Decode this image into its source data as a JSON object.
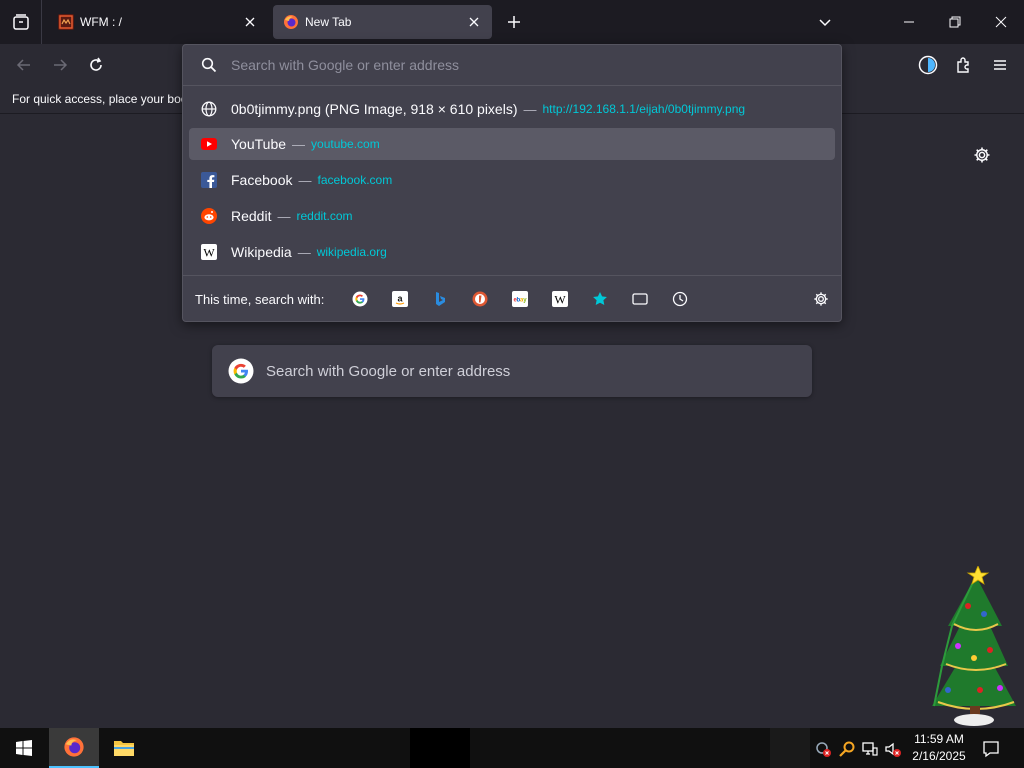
{
  "tabs": [
    {
      "title": "WFM : /",
      "icon": "wfm-icon"
    },
    {
      "title": "New Tab",
      "icon": "firefox-icon"
    }
  ],
  "urlbar": {
    "placeholder": "Search with Google or enter address",
    "results": [
      {
        "title": "0b0tjimmy.png (PNG Image, 918 × 610 pixels)",
        "dash": "—",
        "url": "http://192.168.1.1/eijah/0b0tjimmy.png",
        "icon": "globe-icon",
        "selected": false
      },
      {
        "title": "YouTube",
        "dash": "—",
        "url": "youtube.com",
        "icon": "youtube-icon",
        "selected": true
      },
      {
        "title": "Facebook",
        "dash": "—",
        "url": "facebook.com",
        "icon": "facebook-icon",
        "selected": false
      },
      {
        "title": "Reddit",
        "dash": "—",
        "url": "reddit.com",
        "icon": "reddit-icon",
        "selected": false
      },
      {
        "title": "Wikipedia",
        "dash": "—",
        "url": "wikipedia.org",
        "icon": "wikipedia-icon",
        "selected": false
      }
    ],
    "search_with_label": "This time, search with:",
    "engines": [
      "google-icon",
      "amazon-icon",
      "bing-icon",
      "duckduckgo-icon",
      "ebay-icon",
      "wikipedia-engine-icon",
      "bookmarks-star-icon",
      "tabs-icon",
      "history-icon"
    ]
  },
  "bookmarks_bar": {
    "text": "For quick access, place your bookmarks here on the bookmarks toolbar."
  },
  "content": {
    "search_placeholder": "Search with Google or enter address"
  },
  "taskbar": {
    "time": "11:59 AM",
    "date": "2/16/2025"
  },
  "colors": {
    "accent": "#00c8d7",
    "popup_bg": "#42414d",
    "page_bg": "#2b2a33",
    "tabstrip_bg": "#1c1b22"
  }
}
